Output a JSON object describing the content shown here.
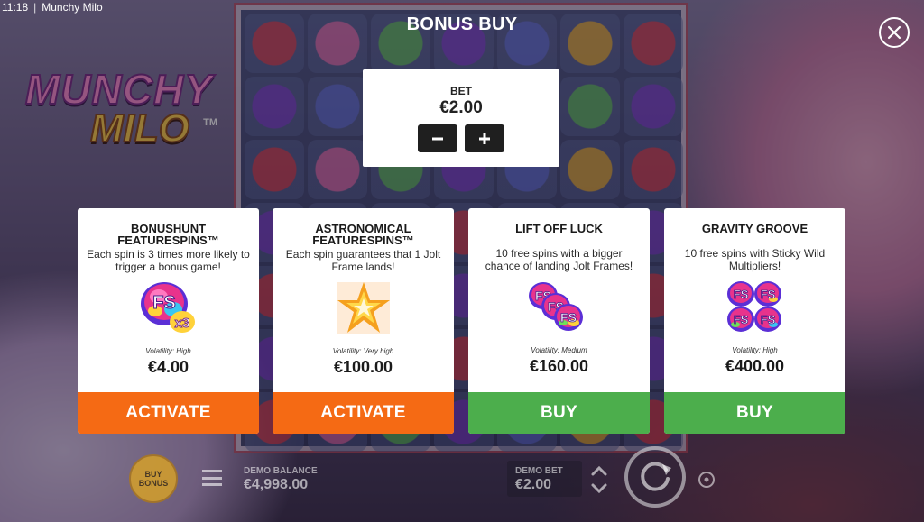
{
  "status_bar": {
    "time": "11:18",
    "app_name": "Munchy Milo"
  },
  "logo": {
    "line1": "MUNCHY",
    "line2": "MILO",
    "tm": "TM"
  },
  "header": {
    "title": "BONUS BUY"
  },
  "bet": {
    "label": "BET",
    "value": "€2.00"
  },
  "cards": [
    {
      "title": "BONUSHUNT FEATURESPINS™",
      "description": "Each spin is 3 times more likely to trigger a bonus game!",
      "icon": "fs-x3-icon",
      "volatility": "Volatility: High",
      "price": "€4.00",
      "button": "ACTIVATE"
    },
    {
      "title": "ASTRONOMICAL FEATURESPINS™",
      "description": "Each spin guarantees that 1 Jolt Frame lands!",
      "icon": "star-burst-icon",
      "volatility": "Volatility: Very high",
      "price": "€100.00",
      "button": "ACTIVATE"
    },
    {
      "title": "LIFT OFF LUCK",
      "description": "10 free spins with a bigger chance of landing Jolt Frames!",
      "icon": "fs-stack-icon",
      "volatility": "Volatility: Medium",
      "price": "€160.00",
      "button": "BUY"
    },
    {
      "title": "GRAVITY GROOVE",
      "description": "10 free spins with Sticky Wild Multipliers!",
      "icon": "fs-grid-icon",
      "volatility": "Volatility: High",
      "price": "€400.00",
      "button": "BUY"
    }
  ],
  "hud": {
    "buy_bonus_line1": "BUY",
    "buy_bonus_line2": "BONUS",
    "balance_label": "DEMO BALANCE",
    "balance_value": "€4,998.00",
    "bet_label": "DEMO BET",
    "bet_value": "€2.00"
  },
  "colors": {
    "activate_button": "#f56a14",
    "buy_button": "#4cae4c",
    "fs_badge_pink": "#e8338c",
    "star_orange": "#f5a01e"
  }
}
